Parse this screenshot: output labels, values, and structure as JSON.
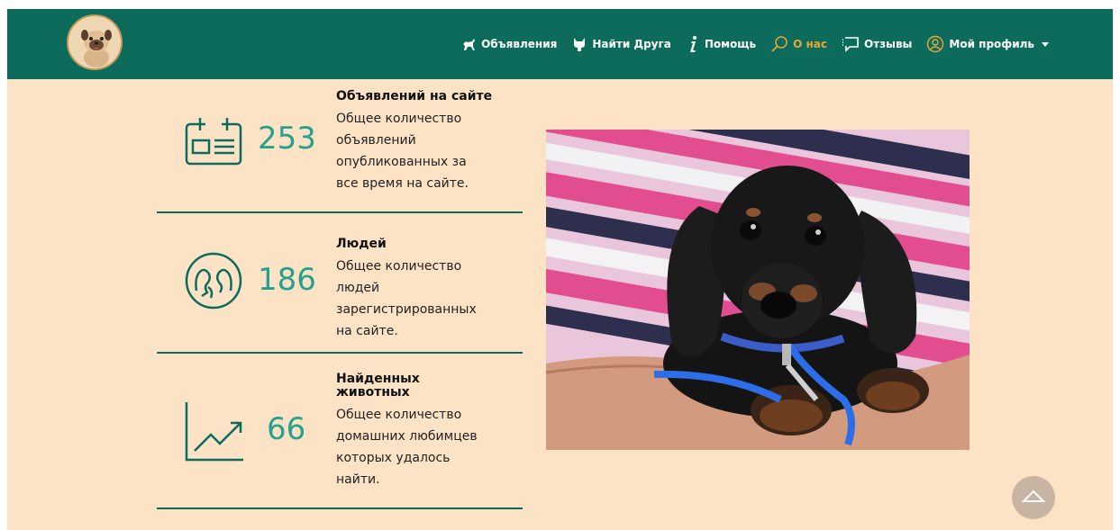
{
  "nav": [
    {
      "label": "Объявления",
      "icon": "dog-icon",
      "active": false
    },
    {
      "label": "Найти Друга",
      "icon": "cat-icon",
      "active": false
    },
    {
      "label": "Помощь",
      "icon": "info-icon",
      "active": false
    },
    {
      "label": "О нас",
      "icon": "magnifier-icon",
      "active": true
    },
    {
      "label": "Отзывы",
      "icon": "chat-bubble-icon",
      "active": false
    },
    {
      "label": "Мой профиль",
      "icon": "user-icon",
      "active": false
    }
  ],
  "stats": [
    {
      "number": "253",
      "title": "Объявлений на сайте",
      "desc_lines": [
        "Общее количество",
        "объявлений",
        "опубликованных за",
        "все время на сайте."
      ],
      "icon": "calendar-icon"
    },
    {
      "number": "186",
      "title": "Людей",
      "desc_lines": [
        "Общее количество",
        "людей",
        "зарегистрированных",
        "на сайте."
      ],
      "icon": "people-icon"
    },
    {
      "number": "66",
      "title_lines": [
        "Найденных",
        "животных"
      ],
      "desc_lines": [
        "Общее количество",
        "домашних любимцев",
        "которых удалось",
        "найти."
      ],
      "icon": "growth-chart-icon"
    }
  ],
  "colors": {
    "header": "#0d6b5b",
    "background": "#fde3c6",
    "accent": "#28a08e",
    "active_nav": "#e8a73a"
  },
  "logo_icon": "pug-logo-icon",
  "scroll_icon": "chevron-up-icon"
}
